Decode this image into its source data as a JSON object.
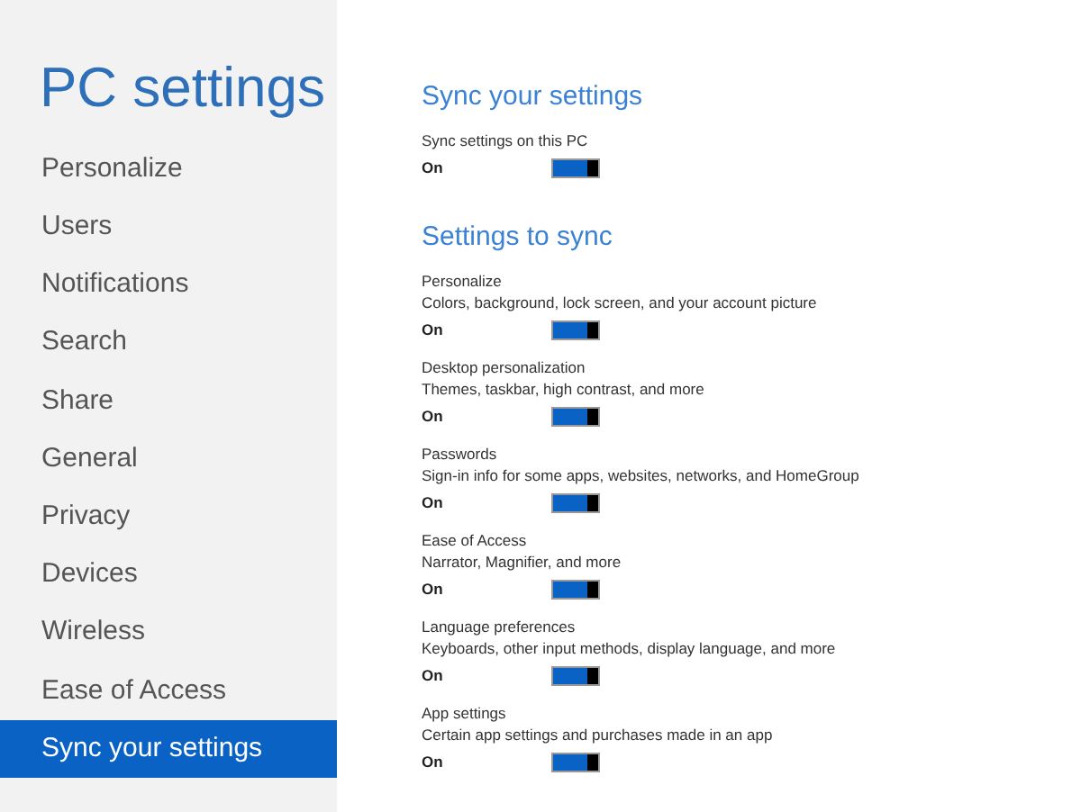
{
  "sidebar": {
    "title": "PC settings",
    "items": [
      {
        "label": "Personalize",
        "selected": false
      },
      {
        "label": "Users",
        "selected": false
      },
      {
        "label": "Notifications",
        "selected": false
      },
      {
        "label": "Search",
        "selected": false
      },
      {
        "label": "Share",
        "selected": false
      },
      {
        "label": "General",
        "selected": false
      },
      {
        "label": "Privacy",
        "selected": false
      },
      {
        "label": "Devices",
        "selected": false
      },
      {
        "label": "Wireless",
        "selected": false
      },
      {
        "label": "Ease of Access",
        "selected": false
      },
      {
        "label": "Sync your settings",
        "selected": true
      }
    ]
  },
  "sections": [
    {
      "heading": "Sync your settings",
      "settings": [
        {
          "label": "Sync settings on this PC",
          "state_label": "On",
          "on": true
        }
      ]
    },
    {
      "heading": "Settings to sync",
      "settings": [
        {
          "label": "Personalize",
          "description": "Colors, background, lock screen, and your account picture",
          "state_label": "On",
          "on": true
        },
        {
          "label": "Desktop personalization",
          "description": "Themes, taskbar, high contrast, and more",
          "state_label": "On",
          "on": true
        },
        {
          "label": "Passwords",
          "description": "Sign-in info for some apps, websites, networks, and HomeGroup",
          "state_label": "On",
          "on": true
        },
        {
          "label": "Ease of Access",
          "description": "Narrator, Magnifier, and more",
          "state_label": "On",
          "on": true
        },
        {
          "label": "Language preferences",
          "description": "Keyboards, other input methods, display language, and more",
          "state_label": "On",
          "on": true
        },
        {
          "label": "App settings",
          "description": "Certain app settings and purchases made in an app",
          "state_label": "On",
          "on": true
        }
      ]
    }
  ]
}
